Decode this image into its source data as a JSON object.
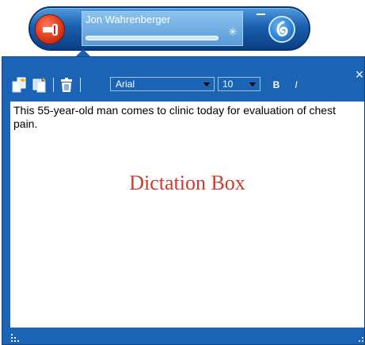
{
  "dictation_bar": {
    "user_name": "Jon Wahrenberger",
    "mic_state": "off",
    "busy_icon": "spinner-icon",
    "logo_icon": "dragon-logo-icon"
  },
  "dictation_box": {
    "watermark": "Dictation Box",
    "toolbar": {
      "font": "Arial",
      "size": "10",
      "bold_label": "B",
      "italic_label": "I"
    },
    "text": "This 55-year-old man comes to clinic today for evaluation of chest pain.",
    "close_label": "×"
  },
  "colors": {
    "window_blue": "#1b63b4",
    "mic_red": "#e03a1a",
    "watermark_red": "#cc3b2f"
  }
}
